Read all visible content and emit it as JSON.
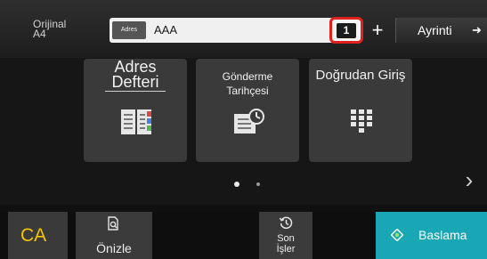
{
  "header": {
    "original_label": "Orijinal",
    "original_size": "A4",
    "address_badge": "Adres",
    "address_value": "AAA",
    "copies": "1",
    "plus_label": "+",
    "detail_label": "Ayrinti",
    "detail_icon": "arrow-right-icon"
  },
  "tiles": [
    {
      "label": "Adres Defteri",
      "label_line1": "Adres",
      "label_line2": "Defteri",
      "icon": "address-book-icon"
    },
    {
      "label": "Gönderme Tarihçesi",
      "icon": "send-history-icon"
    },
    {
      "label": "Doğrudan Giriş",
      "icon": "keypad-icon"
    }
  ],
  "pager": {
    "pages": 2,
    "current": 1
  },
  "footer": {
    "ca_label": "CA",
    "preview_label": "Önizle",
    "jobs_label_line1": "Son",
    "jobs_label_line2": "İşler",
    "start_label": "Baslama"
  },
  "colors": {
    "accent_start": "#1aa7b5",
    "ca_text": "#f4c400",
    "highlight": "#e0221f",
    "background": "#101010",
    "tile": "#3a3a3a"
  }
}
